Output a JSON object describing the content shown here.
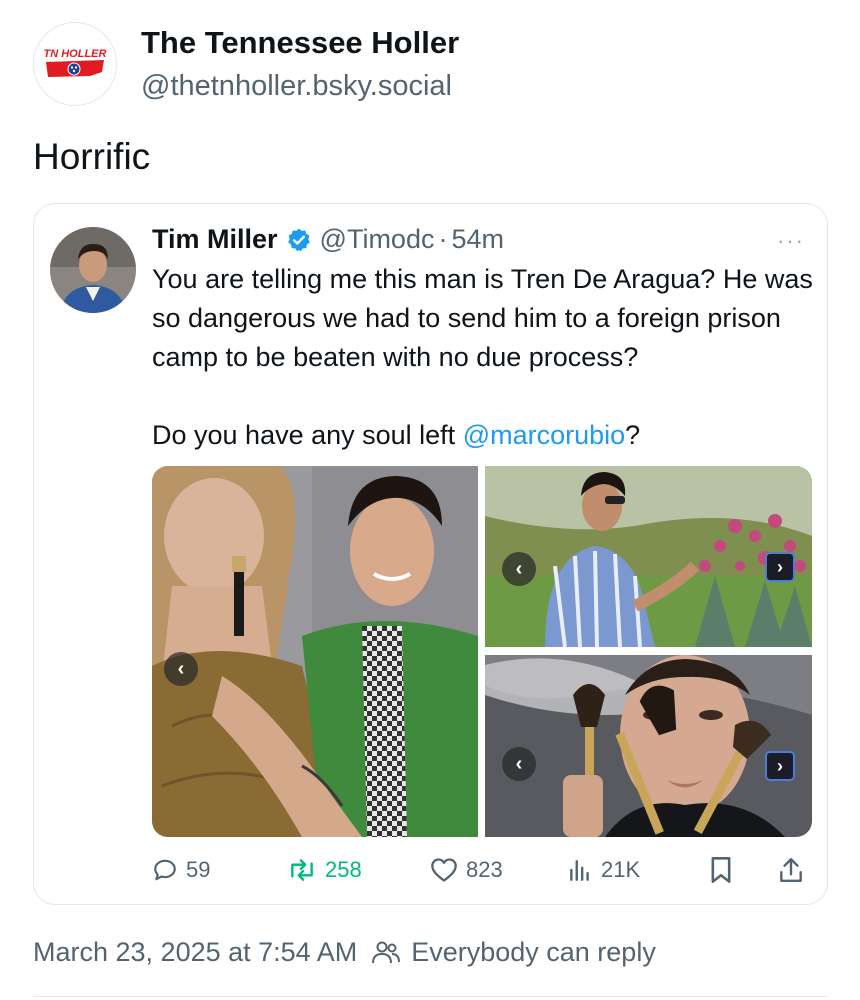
{
  "post": {
    "author_name": "The Tennessee Holler",
    "author_handle": "@thetnholler.bsky.social",
    "logo_text": "TN HOLLER",
    "text": "Horrific",
    "timestamp": "March 23, 2025 at 7:54 AM",
    "reply_setting": "Everybody can reply"
  },
  "quote": {
    "author_name": "Tim Miller",
    "author_handle": "@Timodc",
    "separator": "·",
    "time": "54m",
    "more": "···",
    "body_line1": "You are telling me this man is Tren De Aragua? He was so dangerous we had to send him to a foreign prison camp to be beaten with no due process?",
    "body_line2_prefix": "Do you have any soul left ",
    "body_line2_mention": "@marcorubio",
    "body_line2_suffix": "?",
    "stats": {
      "replies": "59",
      "reposts": "258",
      "likes": "823",
      "views": "21K"
    }
  },
  "nav": {
    "prev": "‹",
    "next": "›"
  },
  "colors": {
    "link": "#1d9bf0",
    "repost_green": "#00ba7c",
    "muted": "#536471",
    "logo_red": "#e21b23",
    "logo_blue": "#1f3f8f"
  },
  "icons": [
    "reply-icon",
    "repost-icon",
    "like-icon",
    "views-icon",
    "bookmark-icon",
    "share-icon",
    "verified-badge-icon",
    "people-icon"
  ]
}
